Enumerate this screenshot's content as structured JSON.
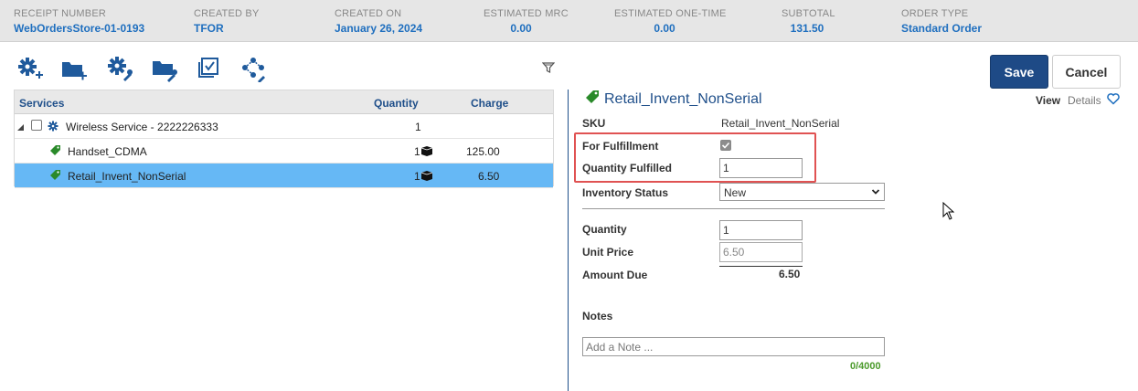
{
  "header": {
    "receipt": {
      "label": "RECEIPT NUMBER",
      "value": "WebOrdersStore-01-0193"
    },
    "created_by": {
      "label": "CREATED BY",
      "value": "TFOR"
    },
    "created_on": {
      "label": "CREATED ON",
      "value": "January 26, 2024"
    },
    "est_mrc": {
      "label": "ESTIMATED MRC",
      "value": "0.00"
    },
    "est_onetime": {
      "label": "ESTIMATED ONE-TIME",
      "value": "0.00"
    },
    "subtotal": {
      "label": "SUBTOTAL",
      "value": "131.50"
    },
    "order_type": {
      "label": "ORDER TYPE",
      "value": "Standard Order"
    }
  },
  "toolbar": {
    "icons": [
      "add-service-icon",
      "add-folder-icon",
      "configure-service-icon",
      "configure-folder-icon",
      "bulk-select-icon",
      "hierarchy-configure-icon"
    ],
    "save_label": "Save",
    "cancel_label": "Cancel"
  },
  "services": {
    "columns": {
      "services": "Services",
      "quantity": "Quantity",
      "charge": "Charge"
    },
    "rows": [
      {
        "name": "Wireless Service - 2222226333",
        "quantity": "1",
        "charge": ""
      },
      {
        "name": "Handset_CDMA",
        "quantity": "1",
        "charge": "125.00"
      },
      {
        "name": "Retail_Invent_NonSerial",
        "quantity": "1",
        "charge": "6.50",
        "selected": true
      }
    ]
  },
  "details": {
    "title": "Retail_Invent_NonSerial",
    "view_label": "View",
    "details_label": "Details",
    "sku_label": "SKU",
    "sku_value": "Retail_Invent_NonSerial",
    "fulfillment_label": "For Fulfillment",
    "fulfillment_checked": true,
    "qty_fulfilled_label": "Quantity Fulfilled",
    "qty_fulfilled_value": "1",
    "inventory_status_label": "Inventory Status",
    "inventory_status_value": "New",
    "quantity_label": "Quantity",
    "quantity_value": "1",
    "unit_price_label": "Unit Price",
    "unit_price_value": "6.50",
    "amount_due_label": "Amount Due",
    "amount_due_value": "6.50",
    "notes_label": "Notes",
    "notes_placeholder": "Add a Note ...",
    "notes_counter": "0/4000"
  },
  "colors": {
    "accent": "#1f6fbf",
    "selected_row": "#66b8f5",
    "highlight_box": "#e05252",
    "save_button": "#1e4a86"
  }
}
